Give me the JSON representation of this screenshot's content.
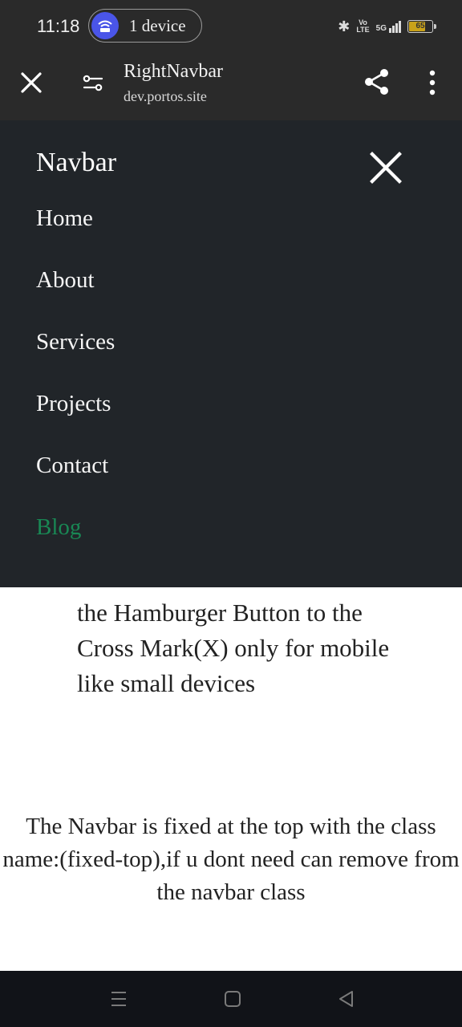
{
  "status_bar": {
    "time": "11:18",
    "hotspot_label": "1 device",
    "volte_top": "Vo",
    "volte_bottom": "LTE",
    "network": "5G",
    "battery": "65"
  },
  "toolbar": {
    "title": "RightNavbar",
    "url": "dev.portos.site"
  },
  "navbar": {
    "brand": "Navbar",
    "items": [
      {
        "label": "Home"
      },
      {
        "label": "About"
      },
      {
        "label": "Services"
      },
      {
        "label": "Projects"
      },
      {
        "label": "Contact"
      },
      {
        "label": "Blog"
      }
    ],
    "accent_color": "#198754"
  },
  "content": {
    "paragraph1": "the Hamburger Button to the Cross Mark(X) only for mobile like small devices",
    "paragraph2": "The Navbar is fixed at the top with the class name:(fixed-top),if u dont need can remove from the navbar class"
  },
  "icons": [
    "close-icon",
    "site-settings-icon",
    "share-icon",
    "more-vert-icon",
    "bluetooth-icon",
    "signal-icon",
    "battery-icon",
    "hotspot-icon",
    "menu-icon",
    "home-icon",
    "back-icon"
  ]
}
